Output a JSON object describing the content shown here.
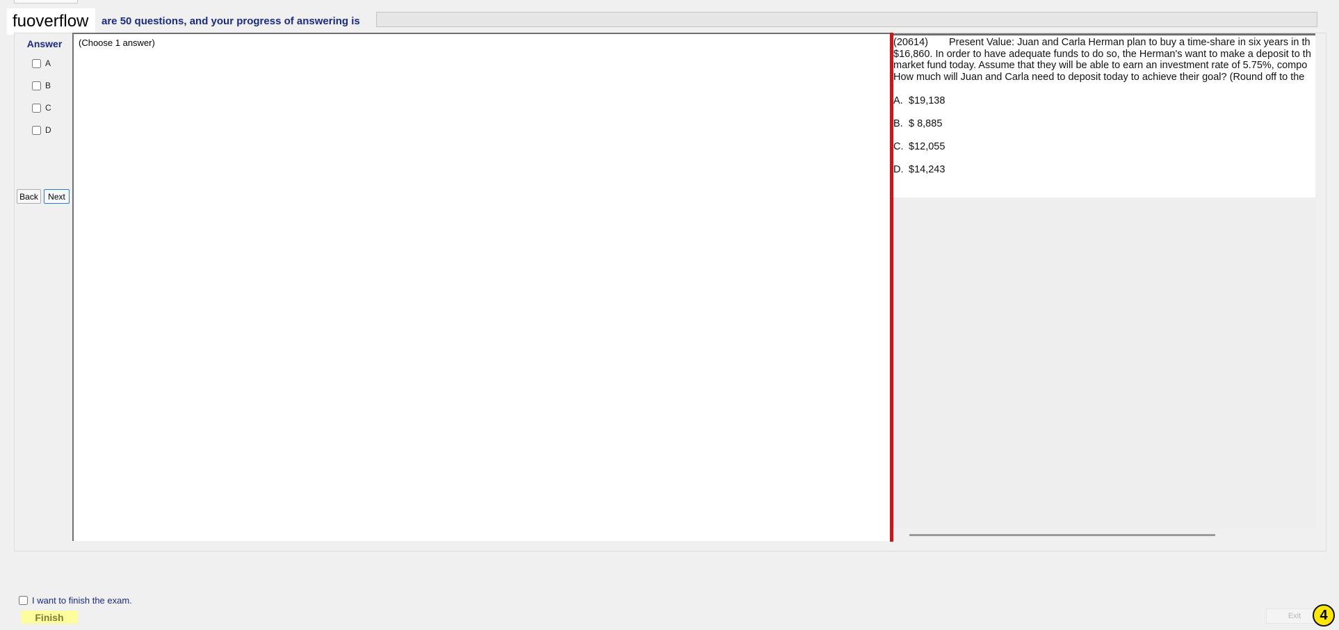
{
  "brand": {
    "label": "fuoverflow"
  },
  "header": {
    "progress_text": "are 50 questions, and your progress of answering is",
    "progress_fraction": 0
  },
  "answer_panel": {
    "title": "Answer",
    "options": [
      {
        "letter": "A",
        "checked": false
      },
      {
        "letter": "B",
        "checked": false
      },
      {
        "letter": "C",
        "checked": false
      },
      {
        "letter": "D",
        "checked": false
      }
    ],
    "back_label": "Back",
    "next_label": "Next"
  },
  "work_area": {
    "hint": "(Choose 1 answer)"
  },
  "question": {
    "id": "(20614)",
    "lines": [
      "Present Value: Juan and Carla Herman plan to buy a time-share in six years in th",
      "$16,860. In order to have adequate funds to do so, the Herman's want to make a deposit to th",
      "market fund today. Assume that they will be able to earn an investment rate of 5.75%, compo",
      "How much will Juan and Carla need to deposit today to achieve their goal? (Round off to the"
    ],
    "choices": [
      {
        "letter": "A.",
        "text": "$19,138"
      },
      {
        "letter": "B.",
        "text": "$ 8,885"
      },
      {
        "letter": "C.",
        "text": "$12,055"
      },
      {
        "letter": "D.",
        "text": "$14,243"
      }
    ]
  },
  "footer": {
    "finish_check_label": "I want to finish the exam.",
    "finish_label": "Finish",
    "exit_label": "Exit",
    "badge": "4"
  }
}
